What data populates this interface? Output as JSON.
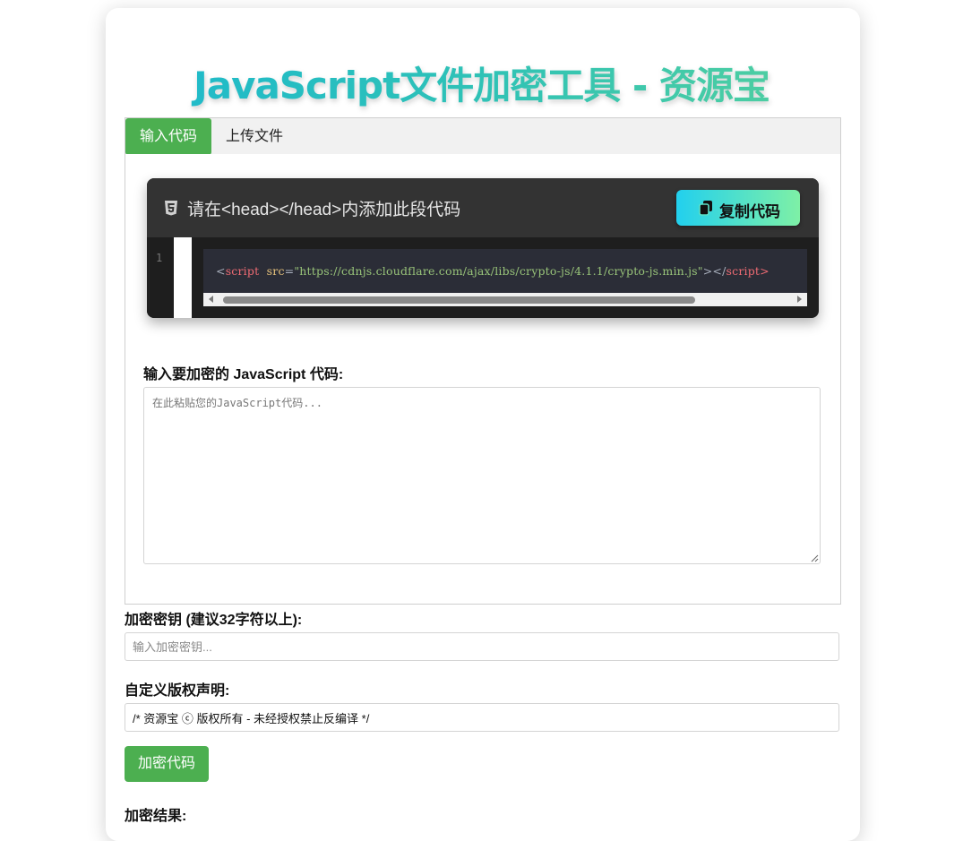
{
  "page": {
    "title": "JavaScript文件加密工具 - 资源宝"
  },
  "tabs": [
    {
      "label": "输入代码",
      "active": true
    },
    {
      "label": "上传文件",
      "active": false
    }
  ],
  "snippet": {
    "title": "请在<head></head>内添加此段代码",
    "copy_label": "复制代码",
    "line_number": "1",
    "code": {
      "open_bracket": "<",
      "tag": "script",
      "attr": "src",
      "equals": "=",
      "value": "\"https://cdnjs.cloudflare.com/ajax/libs/crypto-js/4.1.1/crypto-js.min.js\"",
      "close_open": "></",
      "end_tag": "script>"
    }
  },
  "code_input": {
    "label": "输入要加密的 JavaScript 代码:",
    "placeholder": "在此粘贴您的JavaScript代码..."
  },
  "key_input": {
    "label": "加密密钥 (建议32字符以上):",
    "placeholder": "输入加密密钥..."
  },
  "copyright_input": {
    "label": "自定义版权声明:",
    "value": "/* 资源宝 ⓒ 版权所有 - 未经授权禁止反编译 */"
  },
  "encrypt_button": {
    "label": "加密代码"
  },
  "result": {
    "label": "加密结果:"
  },
  "colors": {
    "primary_green": "#4caf50",
    "title_gradient_start": "#17b6d4",
    "title_gradient_end": "#5fd596",
    "copy_gradient_start": "#22d0ee",
    "copy_gradient_end": "#7ef0a6"
  }
}
